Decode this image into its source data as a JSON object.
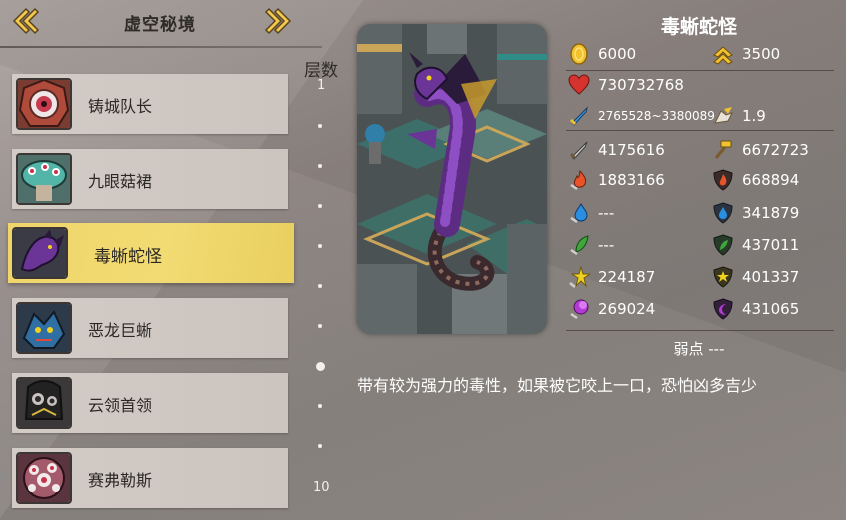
{
  "header": {
    "title": "虚空秘境"
  },
  "monster_list": [
    {
      "name": "铸城队长",
      "selected": false
    },
    {
      "name": "九眼菇裙",
      "selected": false
    },
    {
      "name": "毒蜥蛇怪",
      "selected": true
    },
    {
      "name": "恶龙巨蜥",
      "selected": false
    },
    {
      "name": "云领首领",
      "selected": false
    },
    {
      "name": "赛弗勒斯",
      "selected": false
    }
  ],
  "floors": {
    "label": "层数",
    "first": "1",
    "last": "10",
    "current": 8,
    "total": 10
  },
  "detail": {
    "name": "毒蜥蛇怪",
    "gold": "6000",
    "exp": "3500",
    "hp": "730732768",
    "attack_range": "2765528~3380089",
    "speed": "1.9",
    "physical_atk": "4175616",
    "physical_def": "6672723",
    "fire_atk": "1883166",
    "fire_def": "668894",
    "water_atk": "---",
    "water_def": "341879",
    "wood_atk": "---",
    "wood_def": "437011",
    "light_atk": "224187",
    "light_def": "401337",
    "dark_atk": "269024",
    "dark_def": "431065",
    "weakness": "弱点 ---",
    "description": "带有较为强力的毒性，如果被它咬上一口，恐怕凶多吉少"
  },
  "colors": {
    "selected_row": "#f0d66a",
    "row": "#d3ccc6",
    "gold": "#f2c12e",
    "hp": "#d6332e",
    "fire": "#e8542a",
    "water": "#2a8fe0",
    "wood": "#3fa63b",
    "light": "#f2d21c",
    "dark": "#b43ad6"
  },
  "icons": {
    "prev": "double-chevron-left-icon",
    "next": "double-chevron-right-icon",
    "gold": "gold-coin-icon",
    "exp": "rank-chevron-icon",
    "hp": "heart-icon",
    "attack": "blue-sword-icon",
    "speed": "winged-boot-icon"
  }
}
